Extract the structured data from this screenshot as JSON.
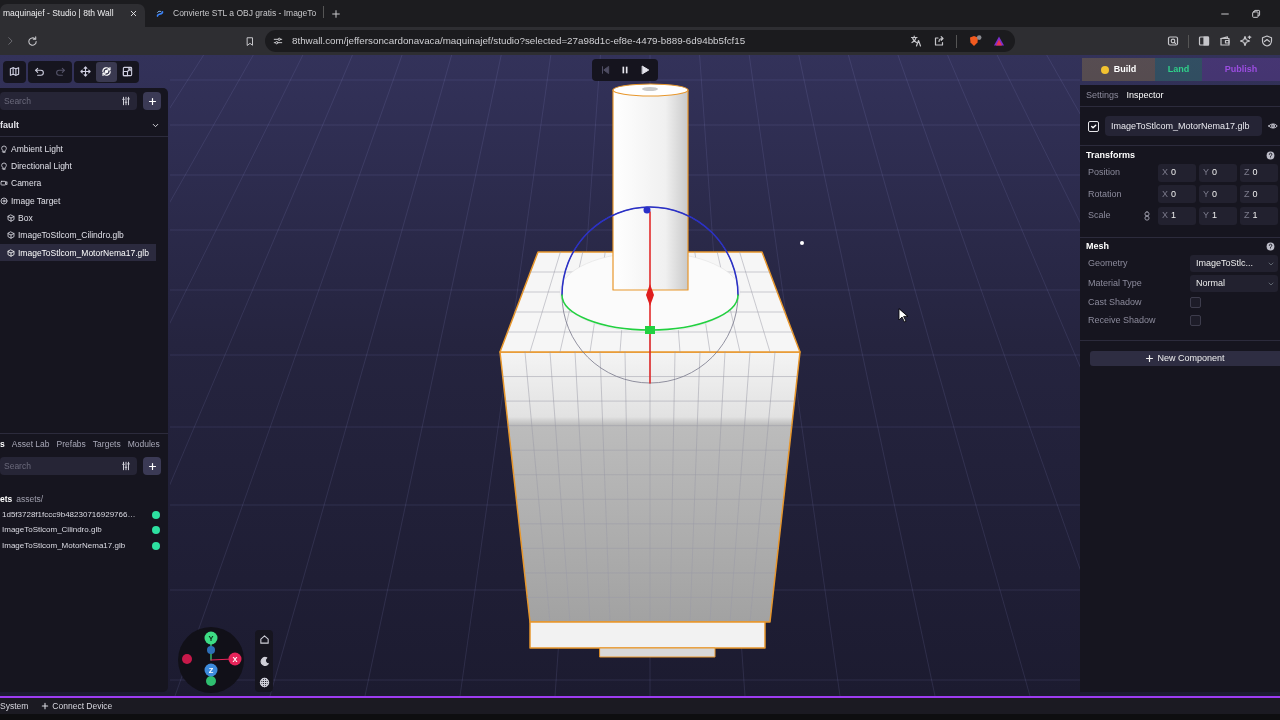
{
  "browser": {
    "tabs": [
      {
        "title": "maquinajef - Studio | 8th Wall",
        "selected": true
      },
      {
        "title": "Convierte STL a OBJ gratis - ImageTo",
        "selected": false
      }
    ],
    "url": "8thwall.com/jeffersoncardonavaca/maquinajef/studio?selected=27a98d1c-ef8e-4479-b889-6d94bb5fcf15"
  },
  "viewport_toolbar": {
    "history": [
      {
        "kind": "undo",
        "disabled": false
      },
      {
        "kind": "redo",
        "disabled": true
      }
    ],
    "transform_tools": [
      {
        "kind": "move",
        "selected": false
      },
      {
        "kind": "rotate",
        "selected": true
      },
      {
        "kind": "scale",
        "selected": false
      }
    ]
  },
  "playback": [
    {
      "kind": "skip_back",
      "disabled": true
    },
    {
      "kind": "pause",
      "disabled": false
    },
    {
      "kind": "play",
      "disabled": false
    }
  ],
  "scene_panel": {
    "search": {
      "placeholder": "Search"
    },
    "space": "fault",
    "tree": [
      {
        "label": "Ambient Light",
        "kind": "light",
        "selected": false
      },
      {
        "label": "Directional Light",
        "kind": "light",
        "selected": false
      },
      {
        "label": "Camera",
        "kind": "camera",
        "selected": false
      },
      {
        "label": "Image Target",
        "kind": "target",
        "selected": false,
        "children": [
          {
            "label": "Box",
            "kind": "mesh",
            "selected": false
          },
          {
            "label": "ImageToStlcom_Cilindro.glb",
            "kind": "mesh",
            "selected": false
          },
          {
            "label": "ImageToStlcom_MotorNema17.glb",
            "kind": "mesh",
            "selected": true
          }
        ]
      }
    ]
  },
  "assets_panel": {
    "tabs": [
      {
        "label": "s",
        "selected": true
      },
      {
        "label": "Asset Lab",
        "selected": false
      },
      {
        "label": "Prefabs",
        "selected": false
      },
      {
        "label": "Targets",
        "selected": false
      },
      {
        "label": "Modules",
        "selected": false
      }
    ],
    "search": {
      "placeholder": "Search"
    },
    "breadcrumb": {
      "root": "ets",
      "path": "assets/"
    },
    "files": [
      {
        "name": "1d5f3728f1fccc9b48230716929766…"
      },
      {
        "name": "ImageToStlcom_Cilindro.glb"
      },
      {
        "name": "ImageToStlcom_MotorNema17.glb"
      }
    ]
  },
  "axis_gizmo": {
    "labels": [
      "Y",
      "X",
      "Z"
    ]
  },
  "mode_tabs": [
    {
      "label": "Build",
      "selected": true,
      "color": "#f2c230"
    },
    {
      "label": "Land",
      "selected": false,
      "color": "#2fd08a"
    },
    {
      "label": "Publish",
      "selected": false,
      "color": "#9b4de0"
    }
  ],
  "inspector": {
    "tabs": [
      {
        "label": "Settings",
        "selected": false
      },
      {
        "label": "Inspector",
        "selected": true
      }
    ],
    "entity": {
      "enabled": true,
      "name": "ImageToStlcom_MotorNema17.glb"
    },
    "sections": [
      {
        "title": "Transforms",
        "rows": [
          {
            "kind": "vector",
            "label": "Position",
            "linked": false,
            "fields": [
              {
                "axis": "X",
                "value": "0"
              },
              {
                "axis": "Y",
                "value": "0"
              },
              {
                "axis": "Z",
                "value": "0"
              }
            ]
          },
          {
            "kind": "vector",
            "label": "Rotation",
            "linked": false,
            "fields": [
              {
                "axis": "X",
                "value": "0"
              },
              {
                "axis": "Y",
                "value": "0"
              },
              {
                "axis": "Z",
                "value": "0"
              }
            ]
          },
          {
            "kind": "vector",
            "label": "Scale",
            "linked": true,
            "fields": [
              {
                "axis": "X",
                "value": "1"
              },
              {
                "axis": "Y",
                "value": "1"
              },
              {
                "axis": "Z",
                "value": "1"
              }
            ]
          }
        ]
      },
      {
        "title": "Mesh",
        "rows": [
          {
            "kind": "select",
            "label": "Geometry",
            "value": "ImageToStlc..."
          },
          {
            "kind": "select",
            "label": "Material Type",
            "value": "Normal"
          },
          {
            "kind": "checkbox",
            "label": "Cast Shadow",
            "checked": false
          },
          {
            "kind": "checkbox",
            "label": "Receive Shadow",
            "checked": false
          }
        ]
      }
    ],
    "add_button": "New Component"
  },
  "status_bar": [
    {
      "label": "System",
      "kind": "text"
    },
    {
      "label": "Connect Device",
      "kind": "add"
    }
  ]
}
